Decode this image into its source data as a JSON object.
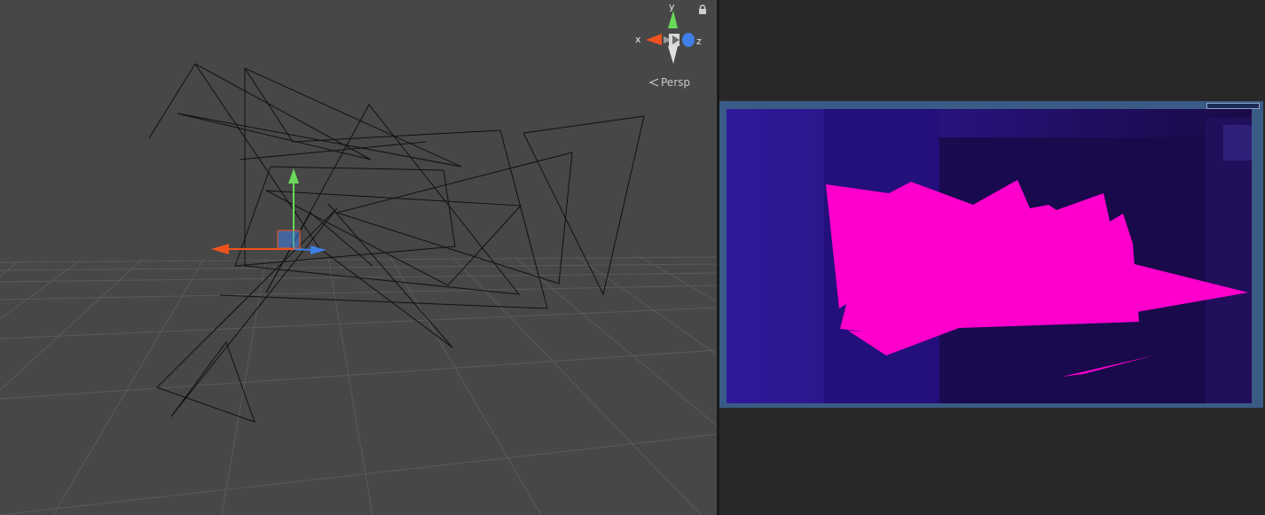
{
  "scene_view": {
    "gizmo": {
      "x_label": "x",
      "y_label": "y",
      "z_label": "z"
    },
    "projection_label": "Persp",
    "icons": {
      "lock": "lock-icon",
      "projection": "chevron-left-icon"
    },
    "colors": {
      "background": "#474747",
      "x_axis": "#f0521f",
      "y_axis": "#6ad95a",
      "z_axis": "#3f7fe8"
    }
  },
  "game_view": {
    "colors": {
      "frame": "#3a5b85",
      "camera_background": "#2a1477",
      "mesh_fill": "#ff00cc"
    }
  }
}
